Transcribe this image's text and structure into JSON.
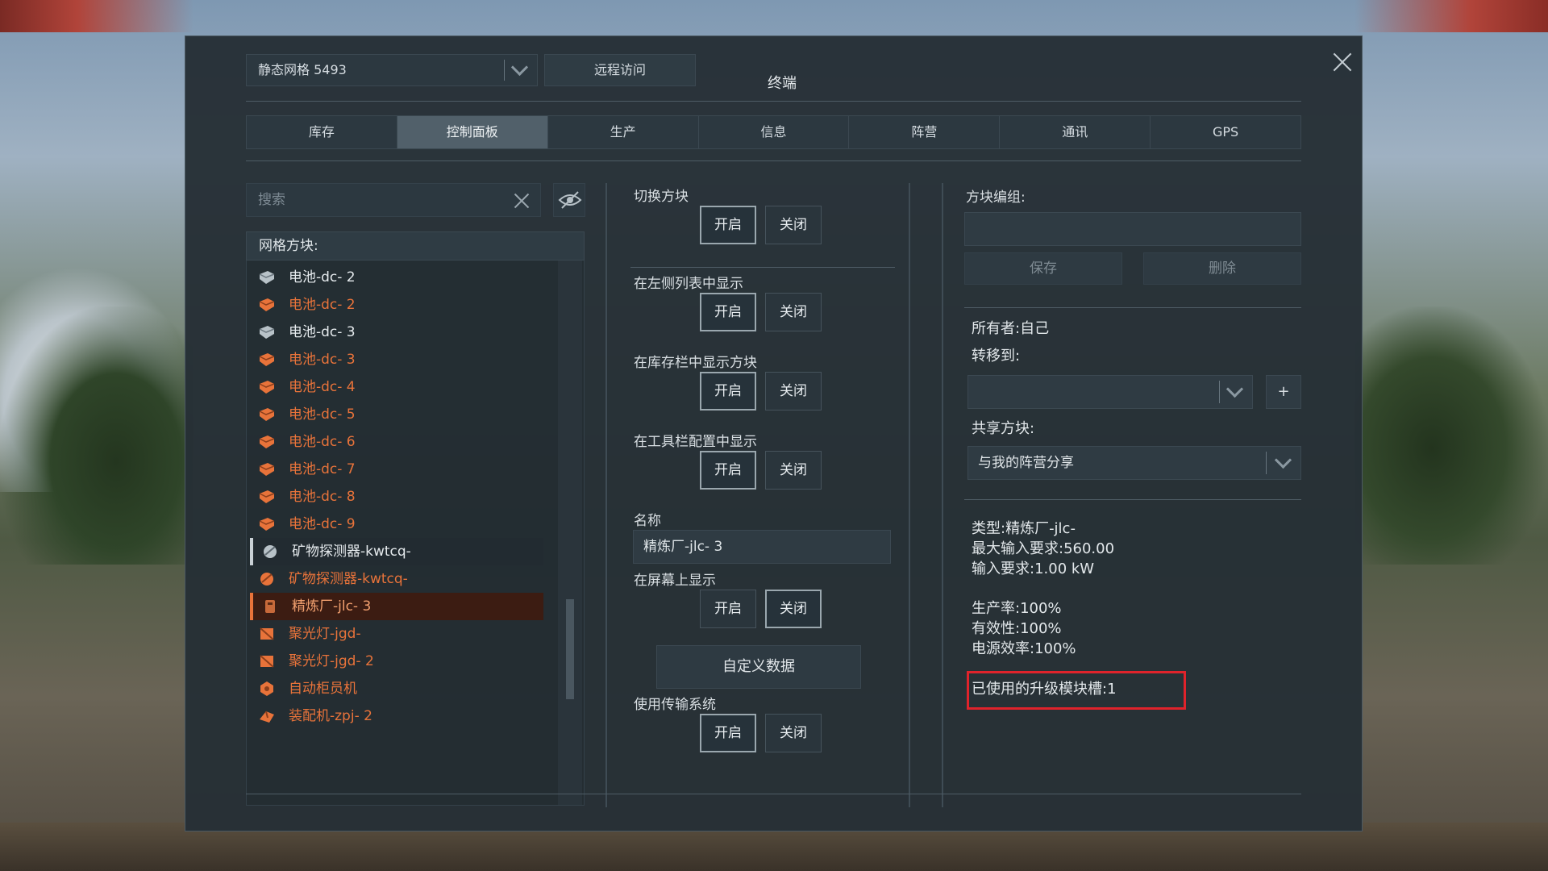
{
  "grid_selector": {
    "value": "静态网格 5493"
  },
  "remote_access_label": "远程访问",
  "window_title": "终端",
  "tabs": [
    {
      "label": "库存"
    },
    {
      "label": "控制面板",
      "active": true
    },
    {
      "label": "生产"
    },
    {
      "label": "信息"
    },
    {
      "label": "阵营"
    },
    {
      "label": "通讯"
    },
    {
      "label": "GPS"
    }
  ],
  "search": {
    "placeholder": "搜索"
  },
  "grid_blocks_header": "网格方块:",
  "blocks": [
    {
      "label": "电池-dc- 2",
      "color": "white",
      "icon": "battery-icon"
    },
    {
      "label": "电池-dc- 2",
      "color": "orange",
      "icon": "battery-icon"
    },
    {
      "label": "电池-dc- 3",
      "color": "white",
      "icon": "battery-icon"
    },
    {
      "label": "电池-dc- 3",
      "color": "orange",
      "icon": "battery-icon"
    },
    {
      "label": "电池-dc- 4",
      "color": "orange",
      "icon": "battery-icon"
    },
    {
      "label": "电池-dc- 5",
      "color": "orange",
      "icon": "battery-icon"
    },
    {
      "label": "电池-dc- 6",
      "color": "orange",
      "icon": "battery-icon"
    },
    {
      "label": "电池-dc- 7",
      "color": "orange",
      "icon": "battery-icon"
    },
    {
      "label": "电池-dc- 8",
      "color": "orange",
      "icon": "battery-icon"
    },
    {
      "label": "电池-dc- 9",
      "color": "orange",
      "icon": "battery-icon"
    },
    {
      "label": "矿物探测器-kwtcq-",
      "color": "white",
      "icon": "ore-detector-icon",
      "state": "selected-dark"
    },
    {
      "label": "矿物探测器-kwtcq-",
      "color": "orange",
      "icon": "ore-detector-icon"
    },
    {
      "label": "精炼厂-jlc- 3",
      "color": "orange",
      "icon": "refinery-icon",
      "state": "selected"
    },
    {
      "label": "聚光灯-jgd-",
      "color": "orange",
      "icon": "spotlight-icon"
    },
    {
      "label": "聚光灯-jgd- 2",
      "color": "orange",
      "icon": "spotlight-icon"
    },
    {
      "label": "自动柜员机",
      "color": "orange",
      "icon": "atm-icon"
    },
    {
      "label": "装配机-zpj- 2",
      "color": "orange",
      "icon": "assembler-icon"
    }
  ],
  "controls": {
    "toggle_block": {
      "label": "切换方块",
      "on": "开启",
      "off": "关闭",
      "selected": "on"
    },
    "show_in_list": {
      "label": "在左侧列表中显示",
      "on": "开启",
      "off": "关闭",
      "selected": "on"
    },
    "show_in_inventory": {
      "label": "在库存栏中显示方块",
      "on": "开启",
      "off": "关闭",
      "selected": "on"
    },
    "show_in_toolbar": {
      "label": "在工具栏配置中显示",
      "on": "开启",
      "off": "关闭",
      "selected": "on"
    },
    "name": {
      "label": "名称",
      "value": "精炼厂-jlc- 3"
    },
    "show_on_screen": {
      "label": "在屏幕上显示",
      "on": "开启",
      "off": "关闭",
      "selected": "off"
    },
    "custom_data_label": "自定义数据",
    "use_conveyor": {
      "label": "使用传输系统",
      "on": "开启",
      "off": "关闭",
      "selected": "on"
    }
  },
  "block_group": {
    "label": "方块编组:",
    "value": "",
    "save_label": "保存",
    "delete_label": "删除"
  },
  "ownership": {
    "owner": "所有者:自己",
    "transfer_label": "转移到:",
    "transfer_value": "",
    "add_label": "+",
    "share_label": "共享方块:",
    "share_value": "与我的阵营分享"
  },
  "details": {
    "type": "类型:精炼厂-jlc-",
    "max_input": "最大输入要求:560.00",
    "input": "输入要求:1.00 kW",
    "productivity": "生产率:100%",
    "effectiveness": "有效性:100%",
    "power_efficiency": "电源效率:100%",
    "upgrade_slots": "已使用的升级模块槽:1"
  },
  "colors": {
    "accent_orange": "#e8733a",
    "highlight_red": "#e0232b",
    "panel_bg": "#262f36"
  }
}
